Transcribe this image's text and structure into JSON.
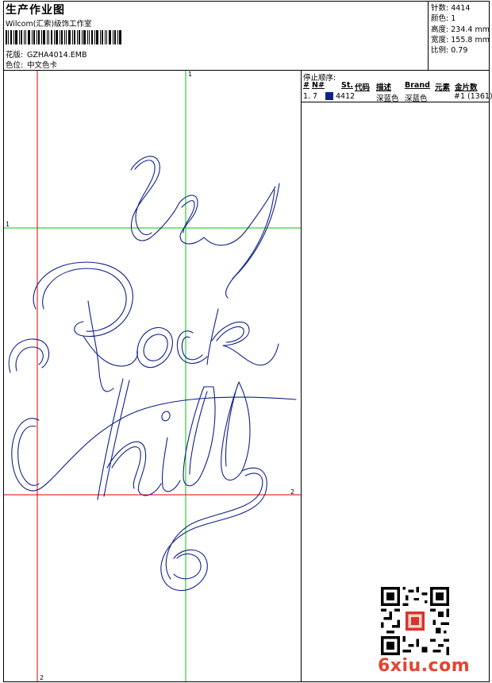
{
  "header": {
    "title": "生产作业图",
    "studio": "Wilcom(汇索)级饰工作室",
    "design_label": "花版:",
    "design_file": "GZHA4014.EMB",
    "color_label": "色位:",
    "color_value": "中文色卡"
  },
  "stats": [
    {
      "label": "针数:",
      "value": "4414"
    },
    {
      "label": "颜色:",
      "value": "1"
    },
    {
      "label": "高度:",
      "value": "234.4 mm"
    },
    {
      "label": "宽度:",
      "value": "155.8 mm"
    },
    {
      "label": "比例:",
      "value": "0.79"
    }
  ],
  "stop_sequence": {
    "title": "停止顺序:",
    "columns": [
      "#",
      "N#",
      "St.",
      "代码",
      "描述",
      "Brand",
      "元素",
      "金片数"
    ],
    "rows": [
      {
        "num": "1.",
        "n": "7",
        "code": "4412",
        "desc": "深蓝色",
        "brand": "深蓝色",
        "elements": "#1 (1361)",
        "swatch_color": "#10208a"
      }
    ]
  },
  "guides": {
    "green_top_label": "1",
    "green_left_label": "1",
    "red_right_label": "2",
    "red_bottom_label": "2"
  },
  "colors": {
    "thread": "#10208a",
    "guide_green": "#00c800",
    "guide_red": "#e00000",
    "watermark": "#e8422e"
  },
  "watermark": {
    "text": "6xiu.com"
  }
}
